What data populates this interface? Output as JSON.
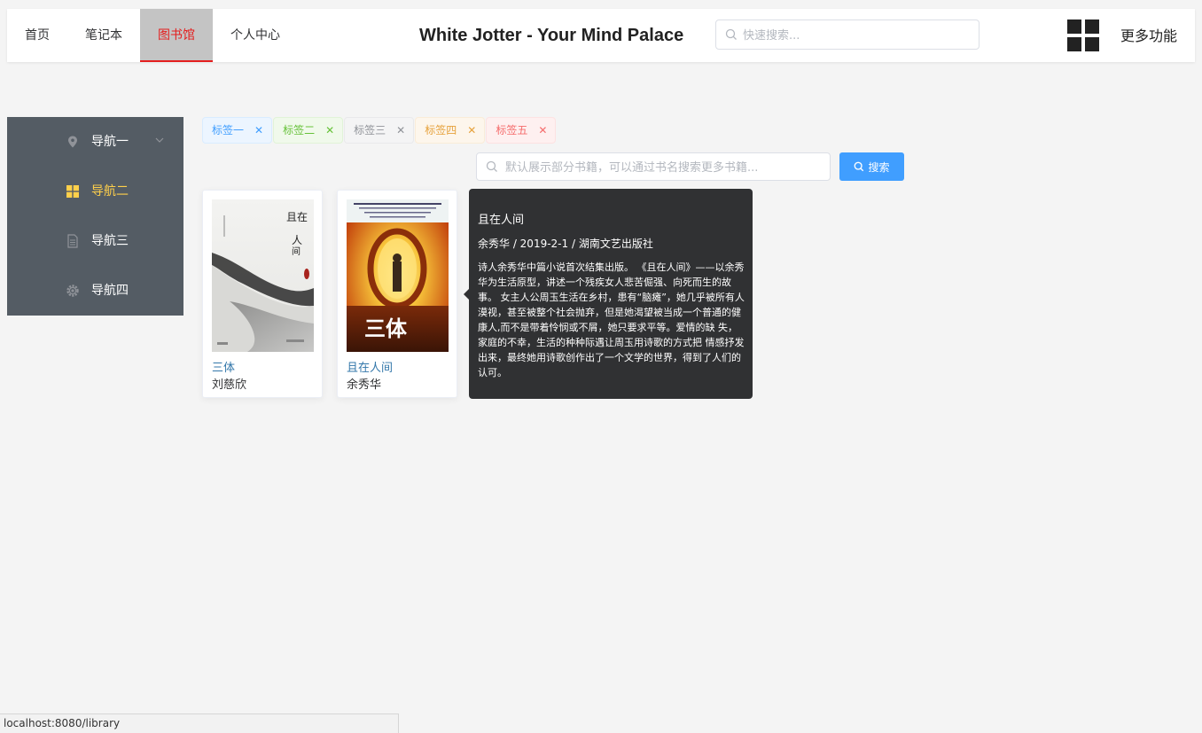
{
  "header": {
    "nav": [
      {
        "label": "首页",
        "active": false
      },
      {
        "label": "笔记本",
        "active": false
      },
      {
        "label": "图书馆",
        "active": true
      },
      {
        "label": "个人中心",
        "active": false
      }
    ],
    "title": "White Jotter - Your Mind Palace",
    "quick_search_placeholder": "快速搜索...",
    "more_label": "更多功能"
  },
  "sidebar": {
    "items": [
      {
        "label": "导航一",
        "icon": "location-icon",
        "active": false
      },
      {
        "label": "导航二",
        "icon": "menu-grid-icon",
        "active": true
      },
      {
        "label": "导航三",
        "icon": "document-icon",
        "active": false
      },
      {
        "label": "导航四",
        "icon": "setting-icon",
        "active": false
      }
    ],
    "accent": "#ffd04b",
    "background": "#545c64"
  },
  "tags": [
    {
      "label": "标签一",
      "color": "#409eff",
      "bg": "#ecf5ff",
      "border": "#d9ecff"
    },
    {
      "label": "标签二",
      "color": "#67c23a",
      "bg": "#f0f9eb",
      "border": "#e1f3d8"
    },
    {
      "label": "标签三",
      "color": "#909399",
      "bg": "#f4f4f5",
      "border": "#e9e9eb"
    },
    {
      "label": "标签四",
      "color": "#e6a23c",
      "bg": "#fdf6ec",
      "border": "#faecd8"
    },
    {
      "label": "标签五",
      "color": "#f56c6c",
      "bg": "#fef0f0",
      "border": "#fde2e2"
    }
  ],
  "search": {
    "placeholder": "默认展示部分书籍，可以通过书名搜索更多书籍...",
    "button_label": "搜索"
  },
  "books": [
    {
      "title": "三体",
      "author": "刘慈欣"
    },
    {
      "title": "且在人间",
      "author": "余秀华"
    }
  ],
  "tooltip": {
    "title": "且在人间",
    "meta": "余秀华 / 2019-2-1 / 湖南文艺出版社",
    "description": "诗人余秀华中篇小说首次结集出版。 《且在人间》——以余秀华为生活原型，讲述一个残疾女人悲苦倔强、向死而生的故事。 女主人公周玉生活在乡村，患有“脑瘫”，她几乎被所有人漠视，甚至被整个社会抛弃，但是她渴望被当成一个普通的健康人,而不是带着怜悯或不屑，她只要求平等。爱情的缺 失，家庭的不幸，生活的种种际遇让周玉用诗歌的方式把 情感抒发出来，最终她用诗歌创作出了一个文学的世界，得到了人们的认可。"
  },
  "cover_art": {
    "book1": [
      "且在",
      "人",
      "间"
    ],
    "book2": "三体"
  },
  "status_url": "localhost:8080/library"
}
